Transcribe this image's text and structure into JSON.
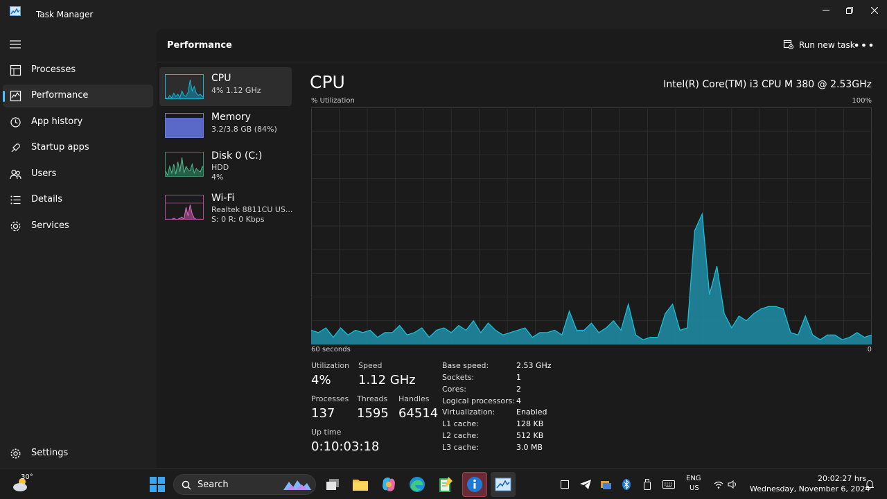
{
  "window": {
    "title": "Task Manager"
  },
  "sidebar": {
    "items": [
      {
        "label": "Processes",
        "icon": "processes-icon"
      },
      {
        "label": "Performance",
        "icon": "performance-icon",
        "active": true
      },
      {
        "label": "App history",
        "icon": "history-icon"
      },
      {
        "label": "Startup apps",
        "icon": "startup-icon"
      },
      {
        "label": "Users",
        "icon": "users-icon"
      },
      {
        "label": "Details",
        "icon": "details-icon"
      },
      {
        "label": "Services",
        "icon": "services-icon"
      }
    ],
    "settings_label": "Settings"
  },
  "header": {
    "title": "Performance",
    "run_task_label": "Run new task"
  },
  "resources": [
    {
      "name": "CPU",
      "sub1": "4%  1.12 GHz",
      "sub2": ""
    },
    {
      "name": "Memory",
      "sub1": "3.2/3.8 GB (84%)",
      "sub2": ""
    },
    {
      "name": "Disk 0 (C:)",
      "sub1": "HDD",
      "sub2": "4%"
    },
    {
      "name": "Wi-Fi",
      "sub1": "Realtek 8811CU US...",
      "sub2": "S: 0 R: 0 Kbps"
    }
  ],
  "detail": {
    "title": "CPU",
    "cpu_name": "Intel(R) Core(TM) i3 CPU M 380 @ 2.53GHz",
    "graph_ylabel": "% Utilization",
    "graph_ymax": "100%",
    "graph_xlabel": "60 seconds",
    "graph_xmin": "0",
    "stats": {
      "utilization_label": "Utilization",
      "utilization": "4%",
      "speed_label": "Speed",
      "speed": "1.12 GHz",
      "processes_label": "Processes",
      "processes": "137",
      "threads_label": "Threads",
      "threads": "1595",
      "handles_label": "Handles",
      "handles": "64514",
      "uptime_label": "Up time",
      "uptime": "0:10:03:18"
    },
    "specs": [
      {
        "k": "Base speed:",
        "v": "2.53 GHz"
      },
      {
        "k": "Sockets:",
        "v": "1"
      },
      {
        "k": "Cores:",
        "v": "2"
      },
      {
        "k": "Logical processors:",
        "v": "4"
      },
      {
        "k": "Virtualization:",
        "v": "Enabled"
      },
      {
        "k": "L1 cache:",
        "v": "128 KB"
      },
      {
        "k": "L2 cache:",
        "v": "512 KB"
      },
      {
        "k": "L3 cache:",
        "v": "3.0 MB"
      }
    ]
  },
  "chart_data": {
    "type": "area",
    "ylim": [
      0,
      100
    ],
    "values": [
      6,
      5,
      7,
      3,
      7,
      4,
      6,
      5,
      6,
      3,
      5,
      5,
      8,
      4,
      5,
      7,
      3,
      6,
      7,
      5,
      8,
      6,
      10,
      5,
      9,
      6,
      4,
      5,
      6,
      7,
      3,
      5,
      5,
      6,
      4,
      14,
      6,
      6,
      9,
      5,
      7,
      10,
      6,
      17,
      4,
      2,
      3,
      3,
      13,
      17,
      6,
      7,
      48,
      55,
      21,
      33,
      13,
      7,
      12,
      10,
      13,
      15,
      16,
      16,
      15,
      5,
      4,
      12,
      4,
      2,
      4,
      4,
      2,
      3,
      5,
      3,
      4
    ],
    "stroke": "#16c0d8",
    "fill": "#1e8ea8"
  },
  "resource_thumbs": {
    "cpu": [
      0.1,
      0.05,
      0.2,
      0.1,
      0.3,
      0.15,
      0.25,
      0.1,
      0.4,
      0.2,
      0.15,
      0.35,
      0.9,
      0.4,
      0.6,
      0.3,
      0.2,
      0.25,
      0.15,
      0.1
    ],
    "disk": [
      0.3,
      0.1,
      0.5,
      0.2,
      0.6,
      0.15,
      0.7,
      0.25,
      0.9,
      0.2,
      0.5,
      0.35,
      0.3,
      0.6,
      0.2,
      0.4,
      0.3,
      0.25,
      0.5,
      0.3
    ],
    "wifi": [
      0.05,
      0.05,
      0.05,
      0.05,
      0.1,
      0.05,
      0.05,
      0.1,
      0.15,
      0.05,
      0.6,
      0.2,
      0.7,
      0.3,
      0.1,
      0.05,
      0.05,
      0.05,
      0.05,
      0.05
    ]
  },
  "taskbar": {
    "weather_temp": "30°",
    "search_placeholder": "Search",
    "lang1": "ENG",
    "lang2": "US",
    "time": "20:02:27 hrs",
    "date": "Wednesday, November 6, 2024"
  },
  "colors": {
    "accent": "#4cc2ff",
    "cpu": "#17b6cf",
    "memory": "#6b79d6",
    "wifi": "#e070c0"
  }
}
